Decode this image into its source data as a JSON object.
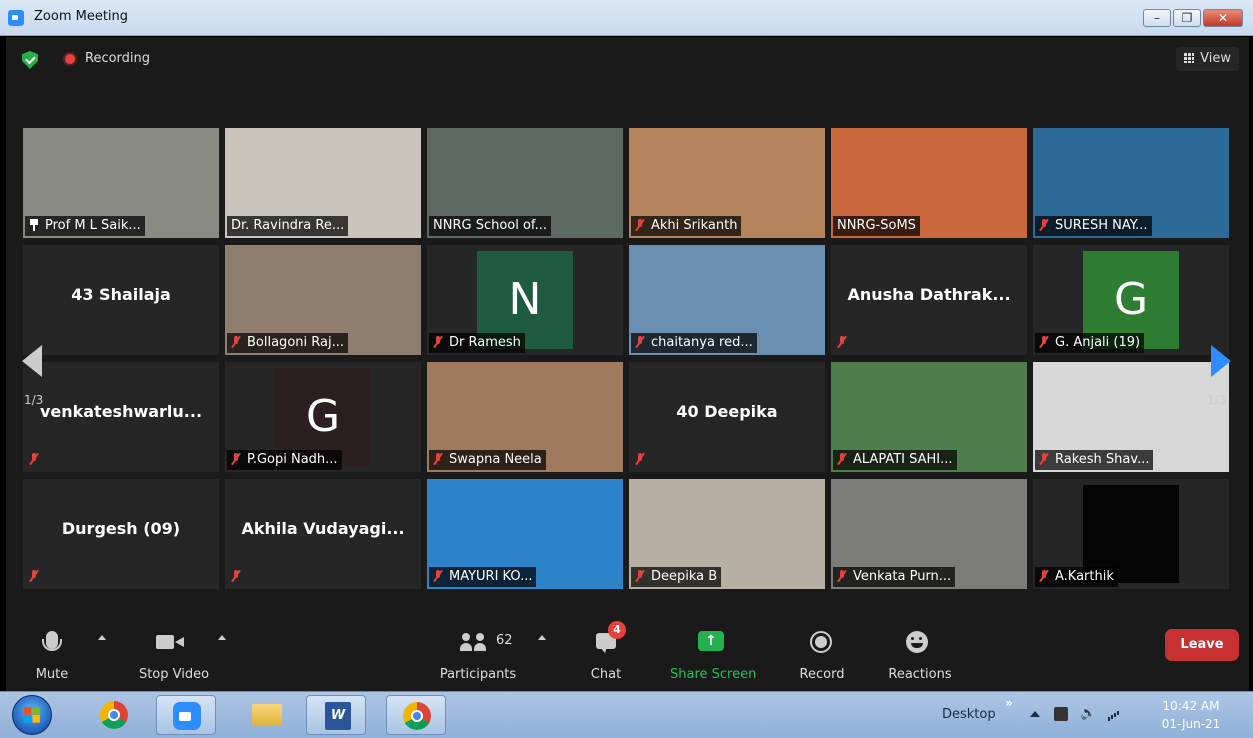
{
  "window": {
    "title": "Zoom Meeting"
  },
  "top": {
    "recording_label": "Recording",
    "view_label": "View"
  },
  "page": {
    "left": "1/3",
    "right": "1/3"
  },
  "tiles": [
    {
      "label": "Prof M L Saik...",
      "type": "video",
      "bg": "#8a8a84",
      "active": true,
      "icon": "pin"
    },
    {
      "label": "Dr. Ravindra Re...",
      "type": "video",
      "bg": "#c9c4bc",
      "icon": ""
    },
    {
      "label": "NNRG School of...",
      "type": "video",
      "bg": "#5d6a63",
      "icon": ""
    },
    {
      "label": "Akhi Srikanth",
      "type": "video",
      "bg": "#b5845c",
      "icon": "mic-off"
    },
    {
      "label": "NNRG-SoMS",
      "type": "video",
      "bg": "#c8683c",
      "icon": ""
    },
    {
      "label": "SURESH NAY...",
      "type": "video",
      "bg": "#2e6a97",
      "icon": "mic-off"
    },
    {
      "label": "",
      "big": "43 Shailaja",
      "type": "name",
      "icon": ""
    },
    {
      "label": "Bollagoni Raj...",
      "type": "video",
      "bg": "#8f7d6e",
      "icon": "mic-off"
    },
    {
      "label": "Dr Ramesh",
      "type": "avatar",
      "letter": "N",
      "avatar_bg": "#1e5b3f",
      "icon": "mic-off"
    },
    {
      "label": "chaitanya red...",
      "type": "video",
      "bg": "#6a8fb0",
      "icon": "mic-off"
    },
    {
      "label": "",
      "big": "Anusha  Dathrak...",
      "type": "name",
      "icon": "mic-off"
    },
    {
      "label": "G. Anjali  (19)",
      "type": "avatar",
      "letter": "G",
      "avatar_bg": "#2e7d32",
      "icon": "mic-off"
    },
    {
      "label": "",
      "big": "venkateshwarlu...",
      "type": "name",
      "icon": "mic-off"
    },
    {
      "label": "P.Gopi Nadh...",
      "type": "avatar",
      "letter": "G",
      "avatar_bg": "#2b1f22",
      "icon": "mic-off"
    },
    {
      "label": "Swapna Neela",
      "type": "video",
      "bg": "#a07a5e",
      "icon": "mic-off"
    },
    {
      "label": "",
      "big": "40 Deepika",
      "type": "name",
      "icon": "mic-off"
    },
    {
      "label": "ALAPATI SAHI...",
      "type": "video",
      "bg": "#4f7d4b",
      "icon": "mic-off"
    },
    {
      "label": "Rakesh Shav...",
      "type": "video",
      "bg": "#d7d7d7",
      "icon": "mic-off"
    },
    {
      "label": "",
      "big": "Durgesh (09)",
      "type": "name",
      "icon": "mic-off"
    },
    {
      "label": "",
      "big": "Akhila  Vudayagi...",
      "type": "name",
      "icon": "mic-off"
    },
    {
      "label": "MAYURI KO...",
      "type": "video",
      "bg": "#2f83c9",
      "icon": "mic-off"
    },
    {
      "label": "Deepika B",
      "type": "video",
      "bg": "#b7b0a2",
      "icon": "mic-off"
    },
    {
      "label": "Venkata Purn...",
      "type": "video",
      "bg": "#7c7c78",
      "icon": "mic-off"
    },
    {
      "label": "A.Karthik",
      "type": "avatar",
      "letter": "",
      "avatar_bg": "#050505",
      "icon": "mic-off"
    }
  ],
  "toolbar": {
    "mute": "Mute",
    "stop_video": "Stop Video",
    "participants": "Participants",
    "participants_count": "62",
    "chat": "Chat",
    "chat_badge": "4",
    "share": "Share Screen",
    "record": "Record",
    "reactions": "Reactions",
    "leave": "Leave"
  },
  "taskbar": {
    "desktop": "Desktop",
    "time": "10:42 AM",
    "date": "01-Jun-21",
    "word_letter": "W"
  }
}
